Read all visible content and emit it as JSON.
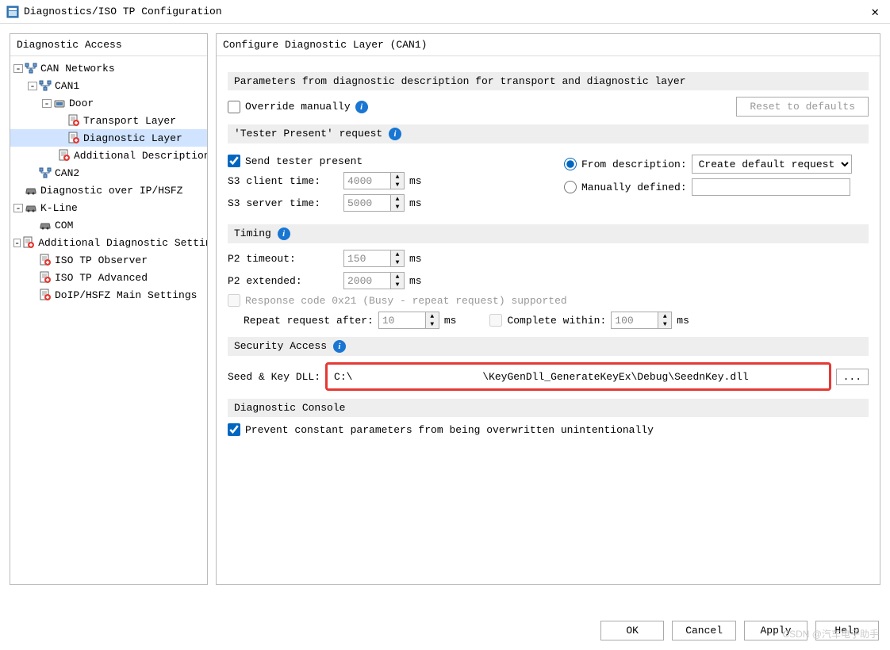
{
  "window": {
    "title": "Diagnostics/ISO TP Configuration"
  },
  "left_panel": {
    "title": "Diagnostic Access",
    "tree": [
      {
        "indent": 0,
        "exp": "-",
        "icon": "net",
        "label": "CAN Networks"
      },
      {
        "indent": 1,
        "exp": "-",
        "icon": "net",
        "label": "CAN1"
      },
      {
        "indent": 2,
        "exp": "-",
        "icon": "dev",
        "label": "Door"
      },
      {
        "indent": 3,
        "exp": "",
        "icon": "doc",
        "label": "Transport Layer"
      },
      {
        "indent": 3,
        "exp": "",
        "icon": "doc",
        "label": "Diagnostic Layer",
        "selected": true
      },
      {
        "indent": 3,
        "exp": "",
        "icon": "doc",
        "label": "Additional Descriptions"
      },
      {
        "indent": 1,
        "exp": "",
        "icon": "net",
        "label": "CAN2"
      },
      {
        "indent": 0,
        "exp": "",
        "icon": "car",
        "label": "Diagnostic over IP/HSFZ"
      },
      {
        "indent": 0,
        "exp": "-",
        "icon": "car",
        "label": "K-Line"
      },
      {
        "indent": 1,
        "exp": "",
        "icon": "car",
        "label": "COM"
      },
      {
        "indent": 0,
        "exp": "-",
        "icon": "doc",
        "label": "Additional Diagnostic Settings"
      },
      {
        "indent": 1,
        "exp": "",
        "icon": "doc",
        "label": "ISO TP Observer"
      },
      {
        "indent": 1,
        "exp": "",
        "icon": "doc",
        "label": "ISO TP Advanced"
      },
      {
        "indent": 1,
        "exp": "",
        "icon": "doc",
        "label": "DoIP/HSFZ Main Settings"
      }
    ]
  },
  "right_panel": {
    "title": "Configure Diagnostic Layer (CAN1)",
    "section_params": "Parameters from diagnostic description for transport and diagnostic layer",
    "override_label": "Override manually",
    "reset_btn": "Reset to defaults",
    "section_tester": "'Tester Present' request",
    "send_tester_label": "Send tester present",
    "s3_client_label": "S3 client time:",
    "s3_client_val": "4000",
    "s3_server_label": "S3 server time:",
    "s3_server_val": "5000",
    "ms": "ms",
    "from_desc_label": "From description:",
    "create_default_opt": "Create default request",
    "manually_label": "Manually defined:",
    "section_timing": "Timing",
    "p2_timeout_label": "P2 timeout:",
    "p2_timeout_val": "150",
    "p2_extended_label": "P2 extended:",
    "p2_extended_val": "2000",
    "busy_label": "Response code 0x21 (Busy - repeat request) supported",
    "repeat_label": "Repeat request after:",
    "repeat_val": "10",
    "complete_label": "Complete within:",
    "complete_val": "100",
    "section_security": "Security Access",
    "seed_key_label": "Seed & Key DLL:",
    "seed_key_val": "C:\\                     \\KeyGenDll_GenerateKeyEx\\Debug\\SeednKey.dll",
    "browse_label": "...",
    "section_console": "Diagnostic Console",
    "prevent_label": "Prevent constant parameters from being overwritten unintentionally"
  },
  "buttons": {
    "ok": "OK",
    "cancel": "Cancel",
    "apply": "Apply",
    "help": "Help"
  },
  "watermark": "CSDN @汽车电子助手"
}
